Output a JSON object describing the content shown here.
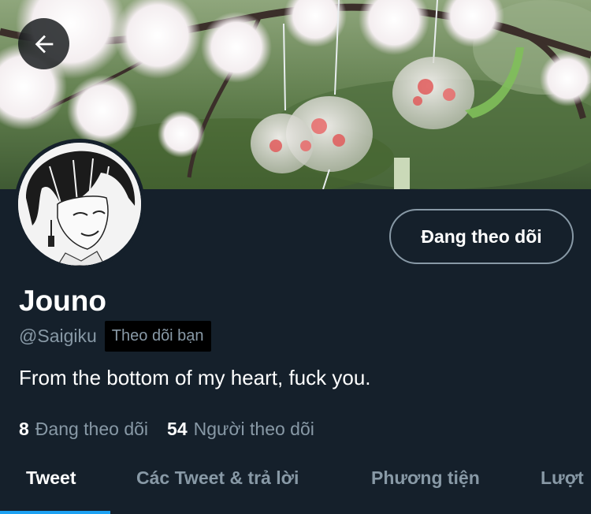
{
  "header": {
    "back_icon": "arrow-left-icon"
  },
  "profile": {
    "follow_button_label": "Đang theo dõi",
    "display_name": "Jouno",
    "handle": "@Saigiku",
    "follows_you_badge": "Theo dõi bạn",
    "bio": "From the bottom of my heart, fuck you."
  },
  "stats": {
    "following_count": "8",
    "following_label": "Đang theo dõi",
    "followers_count": "54",
    "followers_label": "Người theo dõi"
  },
  "tabs": [
    {
      "label": "Tweet",
      "active": true
    },
    {
      "label": "Các Tweet & trả lời",
      "active": false
    },
    {
      "label": "Phương tiện",
      "active": false
    },
    {
      "label": "Lượt",
      "active": false
    }
  ],
  "colors": {
    "background": "#15202b",
    "primary_text": "#ffffff",
    "secondary_text": "#8899a6",
    "accent": "#1da1f2",
    "badge_background": "#000000"
  }
}
